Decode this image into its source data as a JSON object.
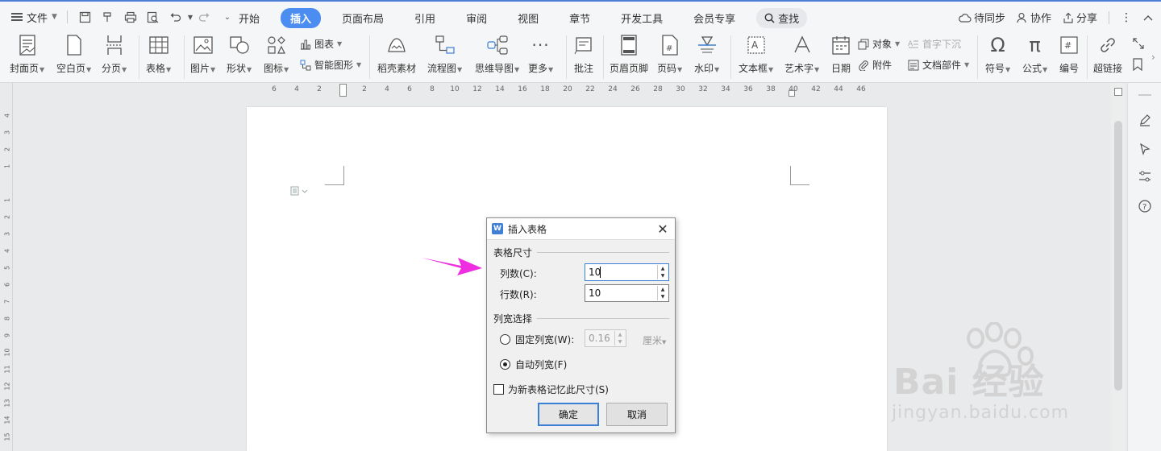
{
  "menubar": {
    "file_label": "文件",
    "tabs": [
      "开始",
      "插入",
      "页面布局",
      "引用",
      "审阅",
      "视图",
      "章节",
      "开发工具",
      "会员专享"
    ],
    "active_tab": "插入",
    "search_label": "查找",
    "sync_label": "待同步",
    "collab_label": "协作",
    "share_label": "分享"
  },
  "ribbon": {
    "cover": "封面页",
    "blank": "空白页",
    "pagebreak": "分页",
    "table": "表格",
    "picture": "图片",
    "shape": "形状",
    "icon": "图标",
    "chart": "图表",
    "smartart": "智能图形",
    "material": "稻壳素材",
    "flowchart": "流程图",
    "mindmap": "思维导图",
    "more": "更多",
    "comment": "批注",
    "headerfooter": "页眉页脚",
    "pagenum": "页码",
    "watermark": "水印",
    "textbox": "文本框",
    "wordart": "艺术字",
    "date": "日期",
    "object": "对象",
    "dropcap": "首字下沉",
    "attachment": "附件",
    "docpart": "文档部件",
    "symbol": "符号",
    "formula": "公式",
    "numbering": "编号",
    "hyperlink": "超链接"
  },
  "ruler": {
    "h_ticks": [
      "6",
      "4",
      "2",
      "",
      "2",
      "4",
      "6",
      "8",
      "10",
      "12",
      "14",
      "16",
      "18",
      "20",
      "22",
      "24",
      "26",
      "28",
      "30",
      "32",
      "34",
      "36",
      "38",
      "40",
      "42",
      "44",
      "46"
    ],
    "v_ticks": [
      "4",
      "3",
      "2",
      "1",
      "",
      "1",
      "2",
      "3",
      "4",
      "5",
      "6",
      "7",
      "8",
      "9",
      "10",
      "11",
      "12",
      "13",
      "14",
      "15"
    ]
  },
  "dialog": {
    "title": "插入表格",
    "size_group": "表格尺寸",
    "cols_label": "列数(C):",
    "cols_value": "10",
    "rows_label": "行数(R):",
    "rows_value": "10",
    "width_group": "列宽选择",
    "fixed_label": "固定列宽(W):",
    "fixed_value": "0.16",
    "fixed_unit": "厘米",
    "auto_label": "自动列宽(F)",
    "remember_label": "为新表格记忆此尺寸(S)",
    "ok_label": "确定",
    "cancel_label": "取消"
  },
  "watermark": {
    "main": "Bai 经验",
    "sub": "jingyan.baidu.com"
  },
  "colors": {
    "accent": "#4b8df0",
    "arrow": "#ee2ee0",
    "dialog_focus": "#3c7fd6"
  }
}
